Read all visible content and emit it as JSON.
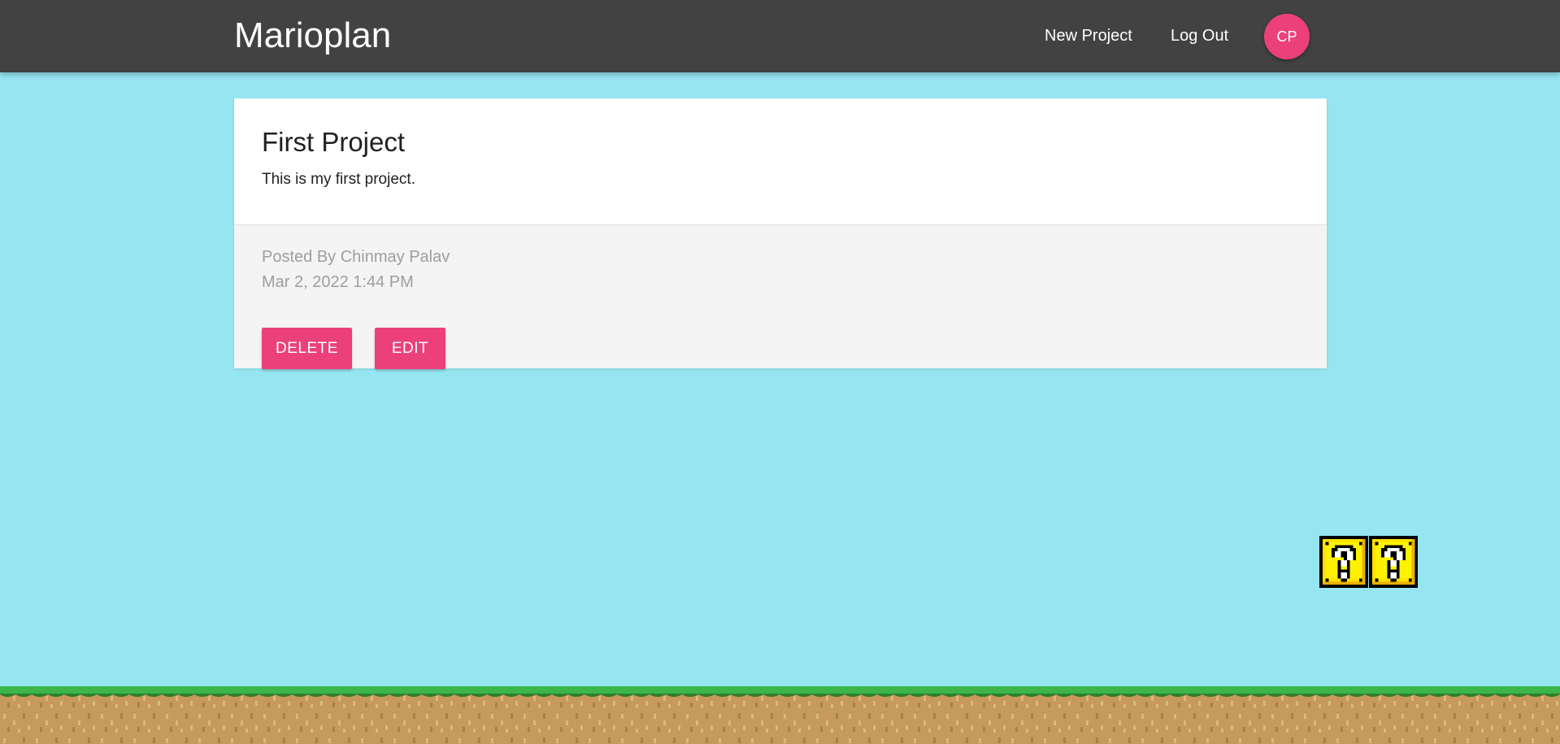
{
  "navbar": {
    "brand": "Marioplan",
    "links": {
      "new_project": "New Project",
      "log_out": "Log Out"
    },
    "avatar_initials": "CP",
    "background": "#424242",
    "avatar_color": "#ec407a"
  },
  "project": {
    "title": "First Project",
    "content": "This is my first project.",
    "posted_by": "Posted By Chinmay Palav",
    "timestamp": "Mar 2, 2022 1:44 PM",
    "actions": {
      "delete_label": "DELETE",
      "edit_label": "EDIT"
    }
  },
  "theme": {
    "sky_color": "#96e6f2",
    "accent": "#ec407a",
    "grass_color": "#3cb54a",
    "dirt_color": "#c59a5a"
  },
  "decorations": {
    "question_blocks": [
      "question-block-icon",
      "question-block-icon"
    ],
    "ground": "grass-ground-icon"
  }
}
